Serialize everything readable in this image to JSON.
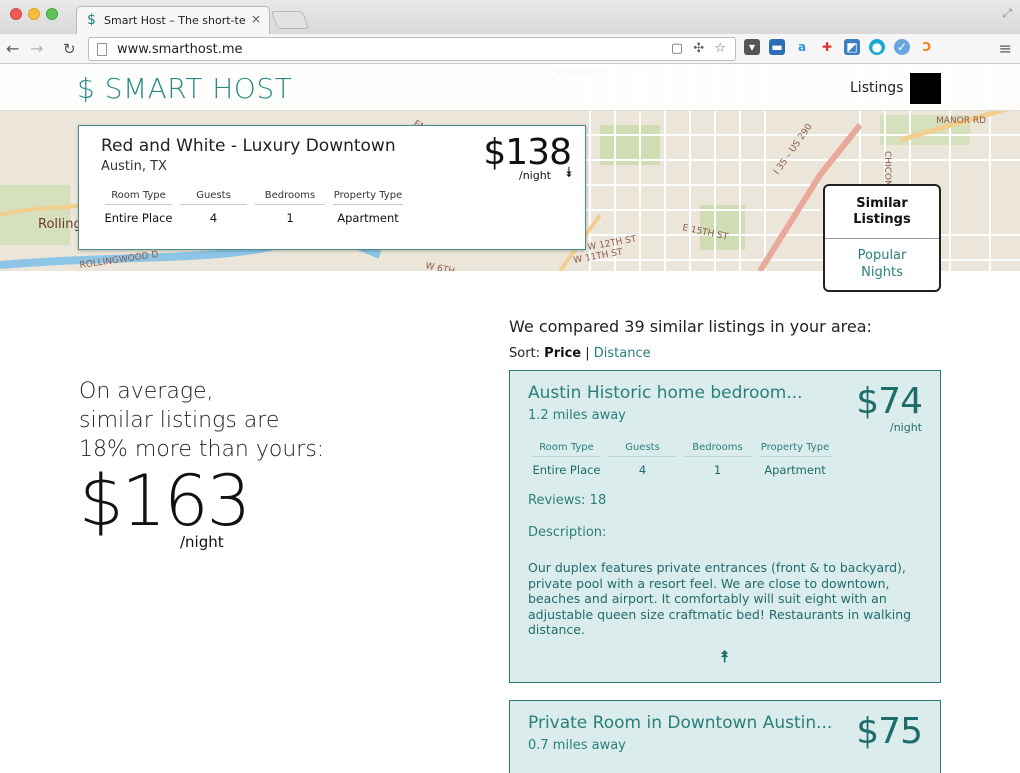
{
  "browser": {
    "tab_favicon": "$",
    "tab_title": "Smart Host – The short-te",
    "tab_close": "×",
    "url": "www.smarthost.me",
    "icons": [
      "back-icon",
      "forward-icon",
      "reload-icon",
      "page-icon",
      "bookmark-star-icon",
      "pocket-icon",
      "menu-icon"
    ]
  },
  "header": {
    "logo": "$ SMART HOST",
    "nav_listings": "Listings"
  },
  "listing": {
    "title": "Red and White - Luxury Downtown",
    "location": "Austin, TX",
    "price": "$138",
    "per_night": "/night",
    "attrs": [
      {
        "label": "Room Type",
        "value": "Entire Place"
      },
      {
        "label": "Guests",
        "value": "4"
      },
      {
        "label": "Bedrooms",
        "value": "1"
      },
      {
        "label": "Property Type",
        "value": "Apartment"
      }
    ]
  },
  "map_labels": [
    "W 24TH ST",
    "MANOR RD",
    "I 35 – US 290",
    "CHICON",
    "E 15TH ST",
    "W 12TH ST",
    "W 11TH ST",
    "W 6TH",
    "ROLLINGWOOD D",
    "Rolling",
    "ENF"
  ],
  "side_tabs": {
    "similar_line1": "Similar",
    "similar_line2": "Listings",
    "popular_line1": "Popular",
    "popular_line2": "Nights"
  },
  "average": {
    "line1": "On average,",
    "line2": "similar listings are",
    "line3": "18% more than yours:",
    "price": "$163",
    "per_night": "/night"
  },
  "comparison": {
    "heading": "We compared 39 similar listings in your area:",
    "sort_label": "Sort:",
    "sort_active": "Price",
    "sort_sep": "|",
    "sort_other": "Distance"
  },
  "similar": [
    {
      "title": "Austin Historic home bedroom...",
      "distance": "1.2 miles away",
      "price": "$74",
      "per_night": "/night",
      "attrs": [
        {
          "label": "Room Type",
          "value": "Entire Place"
        },
        {
          "label": "Guests",
          "value": "4"
        },
        {
          "label": "Bedrooms",
          "value": "1"
        },
        {
          "label": "Property Type",
          "value": "Apartment"
        }
      ],
      "reviews": "Reviews: 18",
      "description_label": "Description:",
      "description": "Our duplex features private entrances (front & to backyard), private pool with a resort feel. We are close to downtown, beaches and airport. It comfortably will suit eight with an adjustable queen size craftmatic bed! Restaurants in walking distance."
    },
    {
      "title": "Private Room in Downtown Austin...",
      "distance": "0.7 miles away",
      "price": "$75"
    }
  ]
}
